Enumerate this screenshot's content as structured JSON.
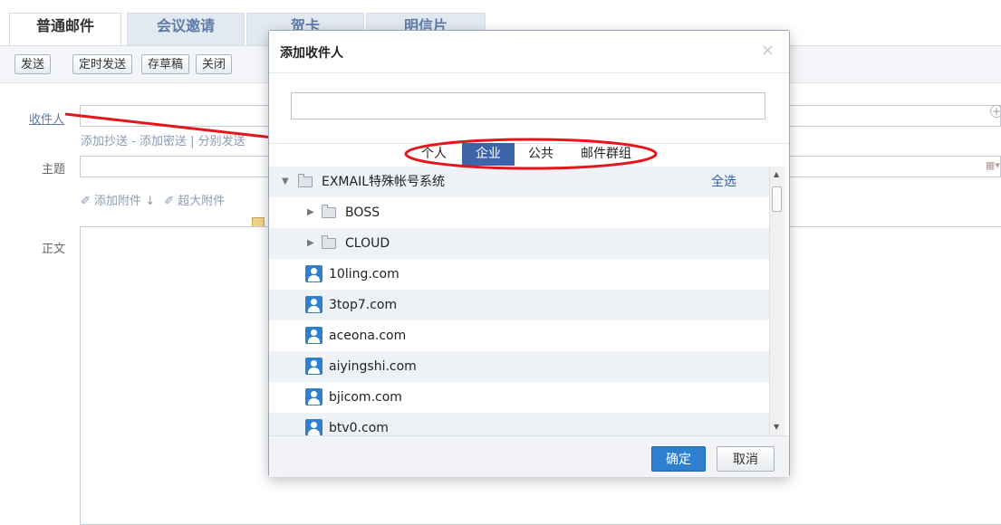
{
  "compose": {
    "tabs": [
      {
        "label": "普通邮件"
      },
      {
        "label": "会议邀请"
      },
      {
        "label": "贺卡"
      },
      {
        "label": "明信片"
      }
    ],
    "toolbar": {
      "send": "发送",
      "scheduled_send": "定时发送",
      "save_draft": "存草稿",
      "close": "关闭"
    },
    "recipient_label": "收件人",
    "cc_links": "添加抄送 - 添加密送 | 分别发送",
    "subject_label": "主题",
    "attach": "添加附件",
    "large_attach": "超大附件",
    "body_label": "正文"
  },
  "dialog": {
    "title": "添加收件人",
    "close": "×",
    "search_value": "",
    "tabs": [
      {
        "label": "个人",
        "active": false
      },
      {
        "label": "企业",
        "active": true
      },
      {
        "label": "公共",
        "active": false
      },
      {
        "label": "邮件群组",
        "active": false
      }
    ],
    "tree_root": {
      "label": "EXMAIL特殊帐号系统",
      "select_all": "全选"
    },
    "folders": [
      "BOSS",
      "CLOUD"
    ],
    "contacts": [
      "10ling.com",
      "3top7.com",
      "aceona.com",
      "aiyingshi.com",
      "bjicom.com",
      "btv0.com"
    ],
    "ok": "确定",
    "cancel": "取消"
  },
  "colors": {
    "accent": "#3d64a8",
    "primary_button": "#2d80cf",
    "annotation": "#e8141b"
  }
}
